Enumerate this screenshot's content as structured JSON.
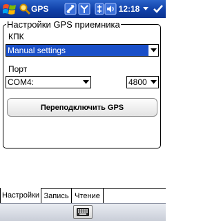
{
  "titlebar": {
    "app_title": "GPS",
    "clock": "12:18",
    "start_icon": "windows-flag-icon",
    "app_icon": "magnifier-icon",
    "indicators": [
      "data-connection-icon",
      "signal-strength-icon",
      "connectivity-icon",
      "volume-icon"
    ],
    "colors": {
      "bar": "#1040a8"
    }
  },
  "settings": {
    "group_title": "Настройки GPS приемника",
    "kpk_label": "КПК",
    "mode_value": "Manual settings",
    "port_label": "Порт",
    "port_value": "COM4:",
    "baud_value": "4800",
    "reconnect_label": "Переподключить GPS",
    "colors": {
      "selection": "#1a4fc8"
    }
  },
  "tabs": [
    {
      "label": "Настройки",
      "active": true
    },
    {
      "label": "Запись",
      "active": false
    },
    {
      "label": "Чтение",
      "active": false
    }
  ],
  "bottombar": {
    "keyboard_icon": "keyboard-icon"
  }
}
